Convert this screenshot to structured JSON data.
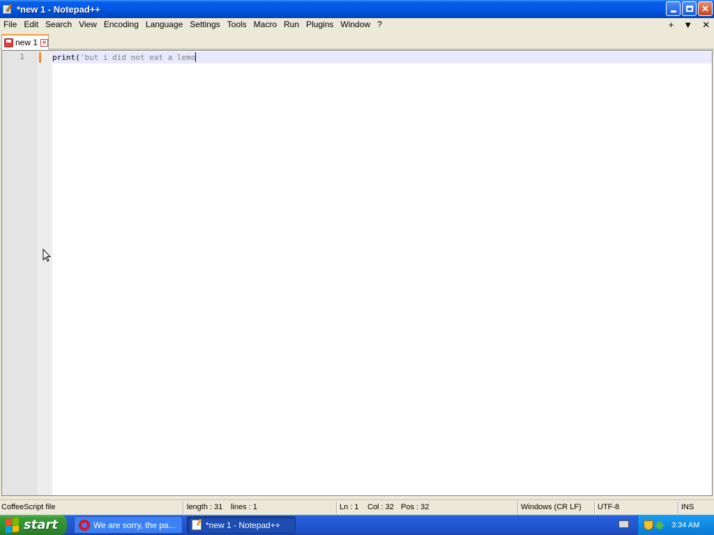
{
  "window": {
    "title": "*new 1 - Notepad++"
  },
  "menu": {
    "items": [
      "File",
      "Edit",
      "Search",
      "View",
      "Encoding",
      "Language",
      "Settings",
      "Tools",
      "Macro",
      "Run",
      "Plugins",
      "Window",
      "?"
    ],
    "right_icons": [
      "+",
      "▼",
      "✕"
    ]
  },
  "tabs": [
    {
      "label": "new 1",
      "close": "⊠",
      "modified": true
    }
  ],
  "editor": {
    "line_number": "1",
    "code_keyword": "print(",
    "code_string": "'but i did not eat a lemo",
    "current_line_color": "#e8e8ff"
  },
  "statusbar": {
    "file_type": "CoffeeScript file",
    "length": "length : 31",
    "lines": "lines : 1",
    "ln": "Ln : 1",
    "col": "Col : 32",
    "pos": "Pos : 32",
    "eol": "Windows (CR LF)",
    "encoding": "UTF-8",
    "mode": "INS"
  },
  "taskbar": {
    "start_label": "start",
    "tasks": [
      {
        "label": "We are sorry, the pa...",
        "icon": "opera-icon",
        "active": false
      },
      {
        "label": "*new 1 - Notepad++",
        "icon": "notepad-icon",
        "active": true
      }
    ],
    "clock": "3:34 AM"
  },
  "colors": {
    "titlebar": "#0058e6",
    "tab_accent": "#fa9a3a",
    "change_marker": "#f28a2a"
  }
}
